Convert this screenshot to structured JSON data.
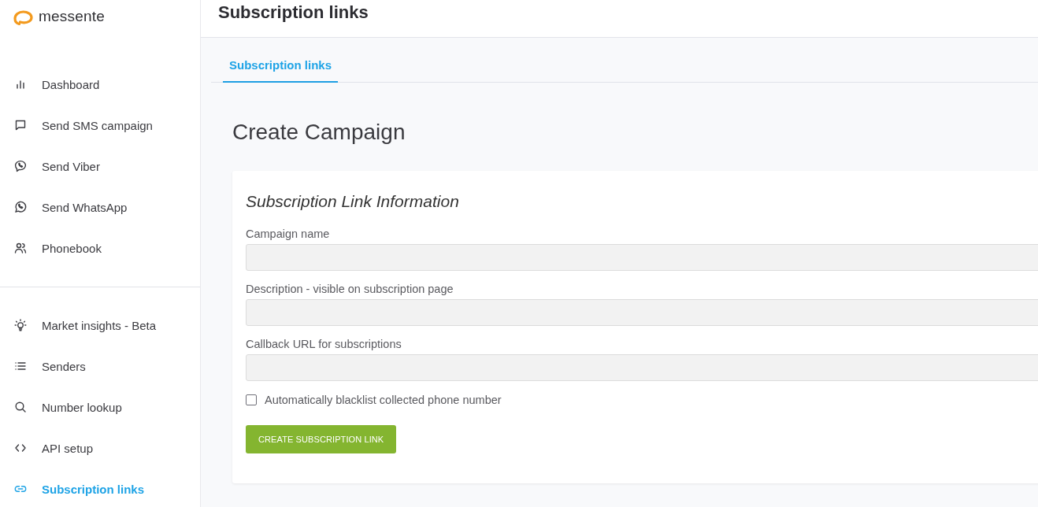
{
  "sidebar": {
    "logo": {
      "text": "messente"
    },
    "nav_groups": [
      {
        "items": [
          {
            "label": "Dashboard",
            "selected": false
          },
          {
            "label": "Send SMS campaign",
            "selected": false
          },
          {
            "label": "Send Viber",
            "selected": false
          },
          {
            "label": "Send WhatsApp",
            "selected": false
          },
          {
            "label": "Phonebook",
            "selected": false
          }
        ]
      },
      {
        "items": [
          {
            "label": "Market insights - Beta",
            "selected": false
          },
          {
            "label": "Senders",
            "selected": false
          },
          {
            "label": "Number lookup",
            "selected": false
          },
          {
            "label": "API setup",
            "selected": false
          },
          {
            "label": "Subscription links",
            "selected": true
          }
        ]
      }
    ]
  },
  "header": {
    "title": "Subscription links"
  },
  "tabs": [
    {
      "label": "Subscription links",
      "selected": true
    }
  ],
  "page_title": "Create Campaign",
  "form": {
    "title": "Subscription Link Information",
    "fields": [
      {
        "label": "Campaign name"
      },
      {
        "label": "Description - visible on subscription page"
      },
      {
        "label": "Callback URL for subscriptions"
      }
    ],
    "checkbox": {
      "label": "Automatically blacklist collected phone number",
      "checked": false
    },
    "submit": {
      "label": "CREATE SUBSCRIPTION LINK"
    }
  }
}
